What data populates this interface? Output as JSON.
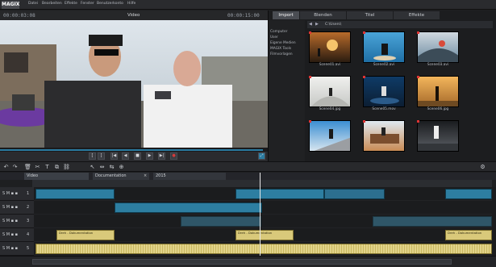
{
  "app": {
    "logo": "MAGIX",
    "menu": [
      "Datei",
      "Bearbeiten",
      "Effekte",
      "Fenster",
      "Benutzerkonto",
      "Hilfe"
    ]
  },
  "preview": {
    "title": "Video",
    "timecode_left": "00:00:03:08",
    "timecode_right": "00:00:15:00"
  },
  "transport": {
    "buttons": [
      "[",
      "]",
      "|◀",
      "◀",
      "■",
      "▶",
      "▶|",
      "●"
    ]
  },
  "media": {
    "tabs": [
      "Import",
      "Blenden",
      "Titel",
      "Effekte"
    ],
    "active_tab": "Import",
    "path": "C:\\Users\\",
    "tree": [
      "Computer",
      "User",
      "Eigene Medien",
      "MAGIX Tools",
      "Filmvorlagen"
    ],
    "files": [
      "Scene01.avi",
      "Scene02.avi",
      "Scene03.avi",
      "Scene04.jpg",
      "Scene05.mov",
      "Scene06.jpg",
      "",
      "",
      ""
    ]
  },
  "timeline": {
    "tabs": [
      "Video",
      "Documentation",
      "2015"
    ],
    "track_labels": [
      "1",
      "2",
      "3",
      "4",
      "5"
    ],
    "clip_captions": [
      "Dreh - Dokumentation",
      "Dreh - Dokumentation",
      "Dreh - Dokumentation"
    ]
  },
  "colors": {
    "accent": "#2d7ea1",
    "audio": "#d9c97a",
    "record": "#d33b3b"
  }
}
